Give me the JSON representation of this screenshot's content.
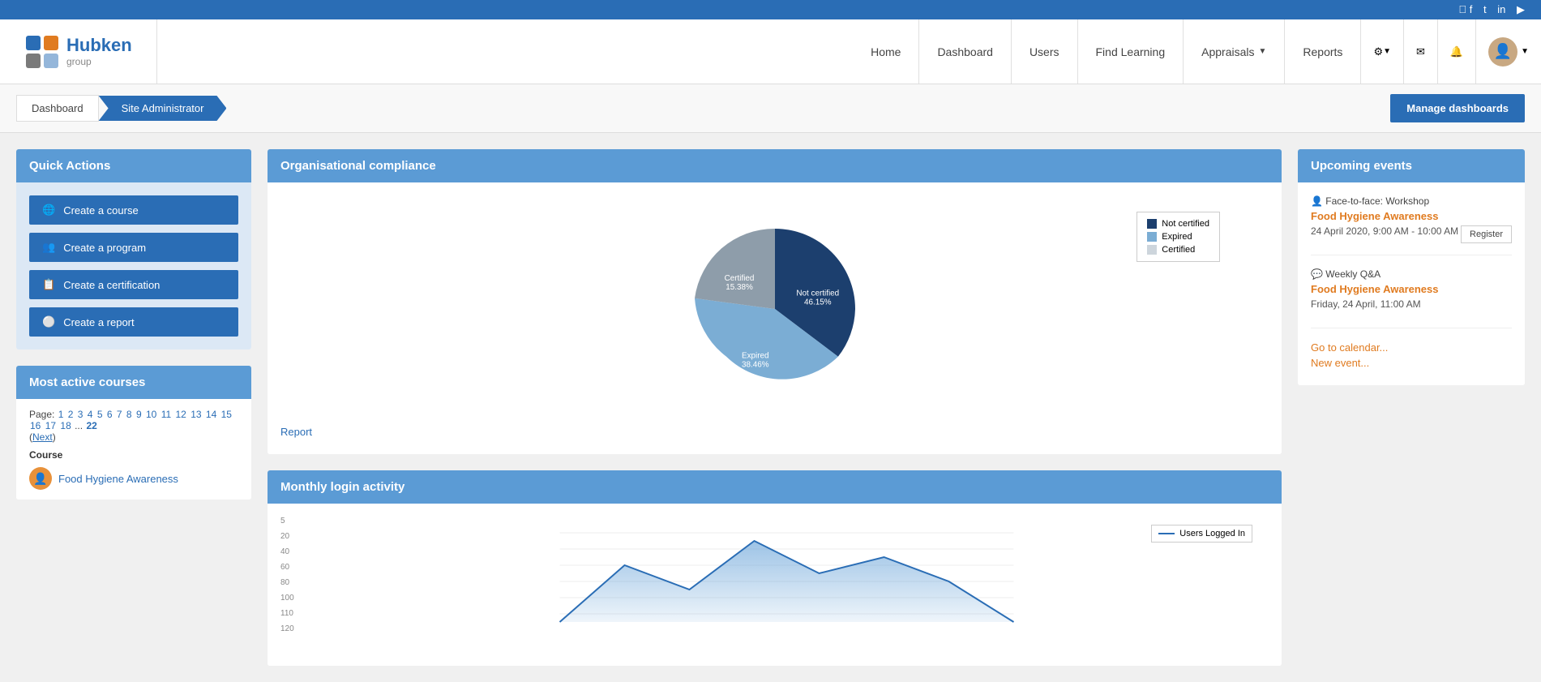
{
  "social_bar": {
    "icons": [
      "facebook",
      "twitter",
      "linkedin",
      "youtube"
    ]
  },
  "navbar": {
    "brand": {
      "name": "Hubken",
      "sub": "group"
    },
    "nav_items": [
      {
        "label": "Home",
        "has_dropdown": false
      },
      {
        "label": "Dashboard",
        "has_dropdown": false
      },
      {
        "label": "Users",
        "has_dropdown": false
      },
      {
        "label": "Find Learning",
        "has_dropdown": false
      },
      {
        "label": "Appraisals",
        "has_dropdown": true
      },
      {
        "label": "Reports",
        "has_dropdown": false
      }
    ]
  },
  "breadcrumb": {
    "items": [
      {
        "label": "Dashboard",
        "active": false
      },
      {
        "label": "Site Administrator",
        "active": true
      }
    ],
    "manage_btn": "Manage dashboards"
  },
  "quick_actions": {
    "title": "Quick Actions",
    "buttons": [
      {
        "label": "Create a course",
        "icon": "globe"
      },
      {
        "label": "Create a program",
        "icon": "users"
      },
      {
        "label": "Create a certification",
        "icon": "cert"
      },
      {
        "label": "Create a report",
        "icon": "circle"
      }
    ]
  },
  "most_active": {
    "title": "Most active courses",
    "pagination": {
      "page_label": "Page:",
      "pages": [
        "1",
        "2",
        "3",
        "4",
        "5",
        "6",
        "7",
        "8",
        "9",
        "10",
        "11",
        "12",
        "13",
        "14",
        "15",
        "16",
        "17",
        "18",
        "...",
        "22"
      ],
      "next": "Next"
    },
    "course_col_label": "Course",
    "courses": [
      {
        "name": "Food Hygiene Awareness",
        "icon": "👤"
      }
    ]
  },
  "compliance": {
    "title": "Organisational compliance",
    "chart": {
      "segments": [
        {
          "label": "Not certified",
          "value": 46.15,
          "color": "#1c3f6e"
        },
        {
          "label": "Expired",
          "value": 38.46,
          "color": "#7badd4"
        },
        {
          "label": "Certified",
          "value": 15.38,
          "color": "#8e9daa"
        }
      ]
    },
    "legend": {
      "items": [
        {
          "label": "Not certified",
          "color": "#1c3f6e"
        },
        {
          "label": "Expired",
          "color": "#7badd4"
        },
        {
          "label": "Certified",
          "color": "#cdd5dc"
        }
      ]
    },
    "report_link": "Report"
  },
  "monthly_login": {
    "title": "Monthly login activity",
    "y_labels": [
      "5",
      "20",
      "40",
      "60",
      "80",
      "100",
      "110",
      "120"
    ],
    "legend": "Users Logged In"
  },
  "upcoming_events": {
    "title": "Upcoming events",
    "events": [
      {
        "type": "Face-to-face: Workshop",
        "title": "Food Hygiene Awareness",
        "date": "24 April 2020, 9:00 AM - 10:00 AM",
        "has_register": true,
        "icon": "👤"
      },
      {
        "type": "Weekly Q&A",
        "title": "Food Hygiene Awareness",
        "date": "Friday, 24 April, 11:00 AM",
        "has_register": false,
        "icon": "💬"
      }
    ],
    "links": [
      "Go to calendar...",
      "New event..."
    ]
  }
}
